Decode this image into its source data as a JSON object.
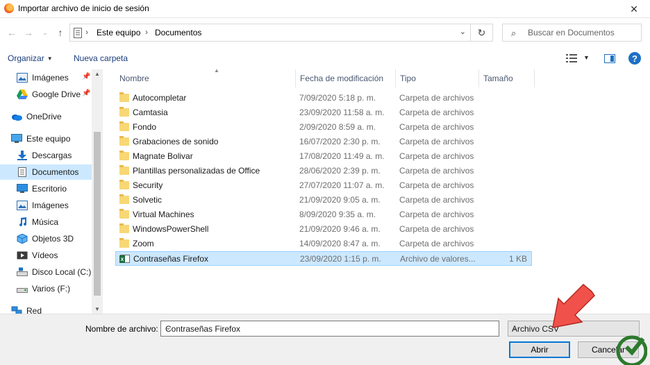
{
  "window": {
    "title": "Importar archivo de inicio de sesión",
    "close_glyph": "✕"
  },
  "address": {
    "crumbs": [
      "Este equipo",
      "Documentos"
    ]
  },
  "search": {
    "placeholder": "Buscar en Documentos"
  },
  "toolbar": {
    "organize_label": "Organizar",
    "new_folder_label": "Nueva carpeta",
    "help_label": "?"
  },
  "nav": {
    "items": [
      {
        "label": "Imágenes",
        "icon": "pictures-icon",
        "pinned": true
      },
      {
        "label": "Google Drive",
        "icon": "google-drive-icon",
        "pinned": true
      },
      {
        "label": "OneDrive",
        "icon": "onedrive-icon"
      },
      {
        "label": "Este equipo",
        "icon": "computer-icon"
      },
      {
        "label": "Descargas",
        "icon": "downloads-icon"
      },
      {
        "label": "Documentos",
        "icon": "documents-icon",
        "selected": true
      },
      {
        "label": "Escritorio",
        "icon": "desktop-icon"
      },
      {
        "label": "Imágenes",
        "icon": "pictures-icon"
      },
      {
        "label": "Música",
        "icon": "music-icon"
      },
      {
        "label": "Objetos 3D",
        "icon": "objects-3d-icon"
      },
      {
        "label": "Vídeos",
        "icon": "videos-icon"
      },
      {
        "label": "Disco Local (C:)",
        "icon": "local-disk-icon"
      },
      {
        "label": "Varios (F:)",
        "icon": "drive-icon"
      },
      {
        "label": "Red",
        "icon": "network-icon"
      }
    ]
  },
  "columns": {
    "name": "Nombre",
    "modified": "Fecha de modificación",
    "type": "Tipo",
    "size": "Tamaño"
  },
  "files": [
    {
      "name": "Autocompletar",
      "modified": "7/09/2020 5:18 p. m.",
      "type": "Carpeta de archivos",
      "size": "",
      "icon": "folder-icon"
    },
    {
      "name": "Camtasia",
      "modified": "23/09/2020 11:58 a. m.",
      "type": "Carpeta de archivos",
      "size": "",
      "icon": "folder-icon"
    },
    {
      "name": "Fondo",
      "modified": "2/09/2020 8:59 a. m.",
      "type": "Carpeta de archivos",
      "size": "",
      "icon": "folder-icon"
    },
    {
      "name": "Grabaciones de sonido",
      "modified": "16/07/2020 2:30 p. m.",
      "type": "Carpeta de archivos",
      "size": "",
      "icon": "folder-icon"
    },
    {
      "name": "Magnate Bolivar",
      "modified": "17/08/2020 11:49 a. m.",
      "type": "Carpeta de archivos",
      "size": "",
      "icon": "folder-icon"
    },
    {
      "name": "Plantillas personalizadas de Office",
      "modified": "28/06/2020 2:39 p. m.",
      "type": "Carpeta de archivos",
      "size": "",
      "icon": "folder-icon"
    },
    {
      "name": "Security",
      "modified": "27/07/2020 11:07 a. m.",
      "type": "Carpeta de archivos",
      "size": "",
      "icon": "folder-icon"
    },
    {
      "name": "Solvetic",
      "modified": "21/09/2020 9:05 a. m.",
      "type": "Carpeta de archivos",
      "size": "",
      "icon": "folder-icon"
    },
    {
      "name": "Virtual Machines",
      "modified": "8/09/2020 9:35 a. m.",
      "type": "Carpeta de archivos",
      "size": "",
      "icon": "folder-icon"
    },
    {
      "name": "WindowsPowerShell",
      "modified": "21/09/2020 9:46 a. m.",
      "type": "Carpeta de archivos",
      "size": "",
      "icon": "folder-icon"
    },
    {
      "name": "Zoom",
      "modified": "14/09/2020 8:47 a. m.",
      "type": "Carpeta de archivos",
      "size": "",
      "icon": "folder-icon"
    },
    {
      "name": "Contraseñas Firefox",
      "modified": "23/09/2020 1:15 p. m.",
      "type": "Archivo de valores...",
      "size": "1 KB",
      "icon": "csv-file-icon",
      "selected": true
    }
  ],
  "footer": {
    "filename_label": "Nombre de archivo:",
    "filename_value": "Contraseñas Firefox",
    "filter_value": "Archivo CSV",
    "open_label": "Abrir",
    "cancel_label": "Cancelar"
  },
  "colors": {
    "selection": "#cce8ff",
    "accent": "#0078d7",
    "folder": "#f8d775",
    "arrow": "#f0524b"
  }
}
